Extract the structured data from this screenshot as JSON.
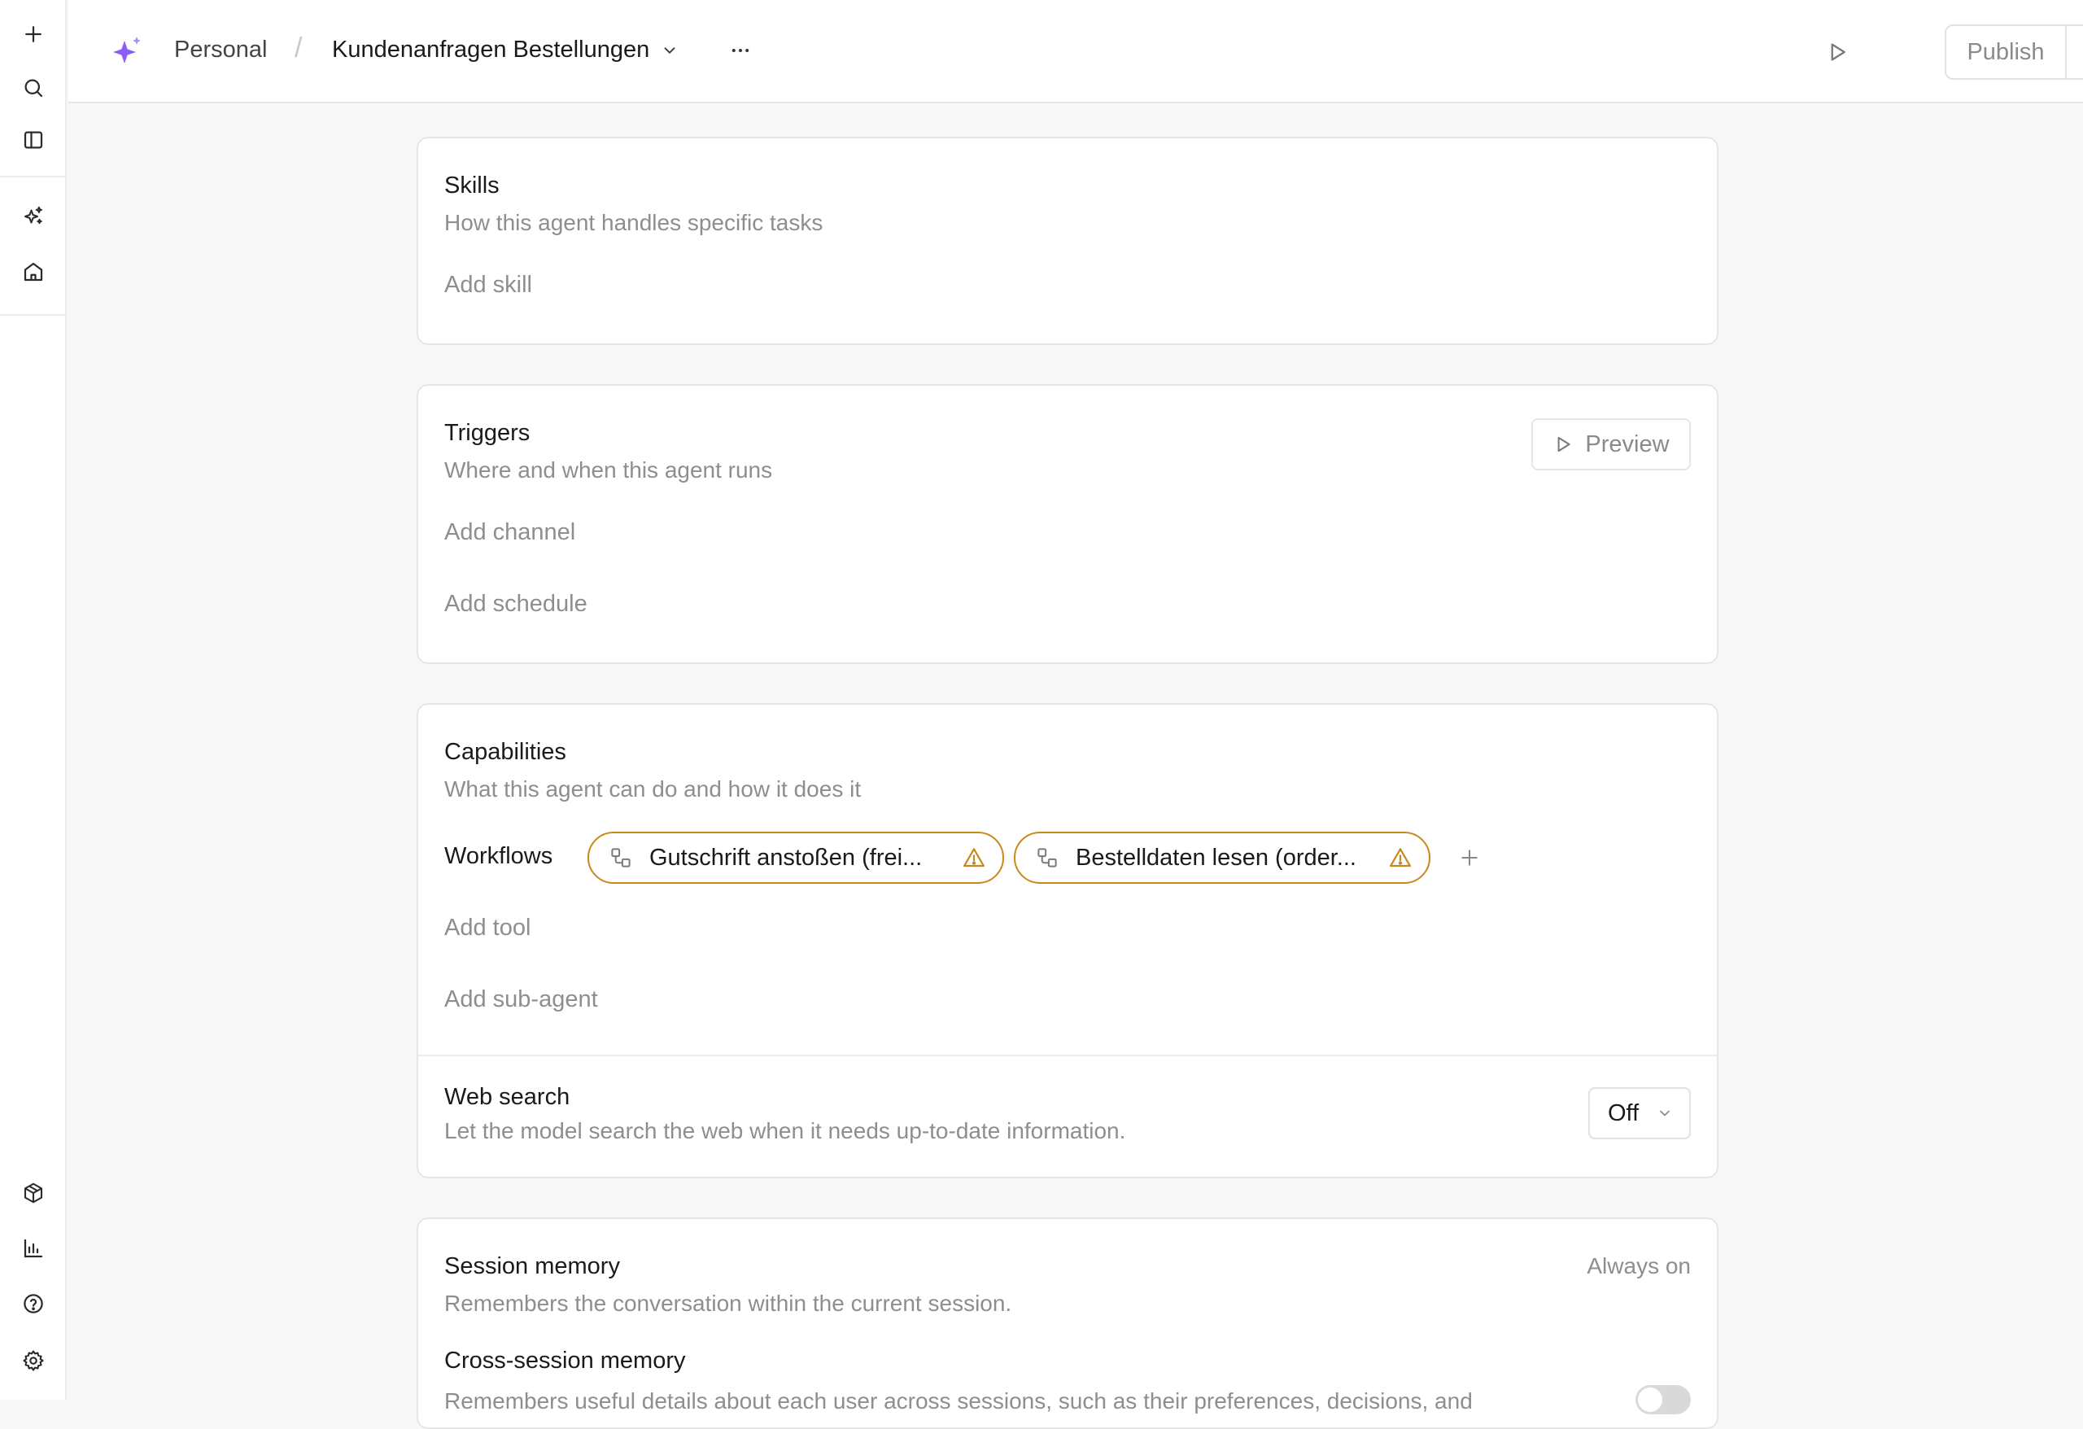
{
  "breadcrumb": {
    "workspace": "Personal",
    "separator": "/",
    "agent_name": "Kundenanfragen Bestellungen"
  },
  "header": {
    "publish_label": "Publish"
  },
  "skills": {
    "title": "Skills",
    "subtitle": "How this agent handles specific tasks",
    "add_label": "Add skill"
  },
  "triggers": {
    "title": "Triggers",
    "subtitle": "Where and when this agent runs",
    "preview_label": "Preview",
    "add_channel": "Add channel",
    "add_schedule": "Add schedule"
  },
  "capabilities": {
    "title": "Capabilities",
    "subtitle": "What this agent can do and how it does it",
    "workflows_label": "Workflows",
    "workflows": [
      {
        "name": "Gutschrift anstoßen (frei...",
        "status": "warning"
      },
      {
        "name": "Bestelldaten lesen (order...",
        "status": "warning"
      }
    ],
    "add_tool": "Add tool",
    "add_subagent": "Add sub-agent",
    "web_search": {
      "title": "Web search",
      "description": "Let the model search the web when it needs up-to-date information.",
      "value": "Off"
    }
  },
  "memory": {
    "session_title": "Session memory",
    "session_description": "Remembers the conversation within the current session.",
    "session_status": "Always on",
    "cross_title": "Cross-session memory",
    "cross_description": "Remembers useful details about each user across sessions, such as their preferences, decisions, and",
    "cross_enabled": false
  },
  "colors": {
    "accent_purple": "#8b5cf6",
    "warning": "#c8891a"
  }
}
